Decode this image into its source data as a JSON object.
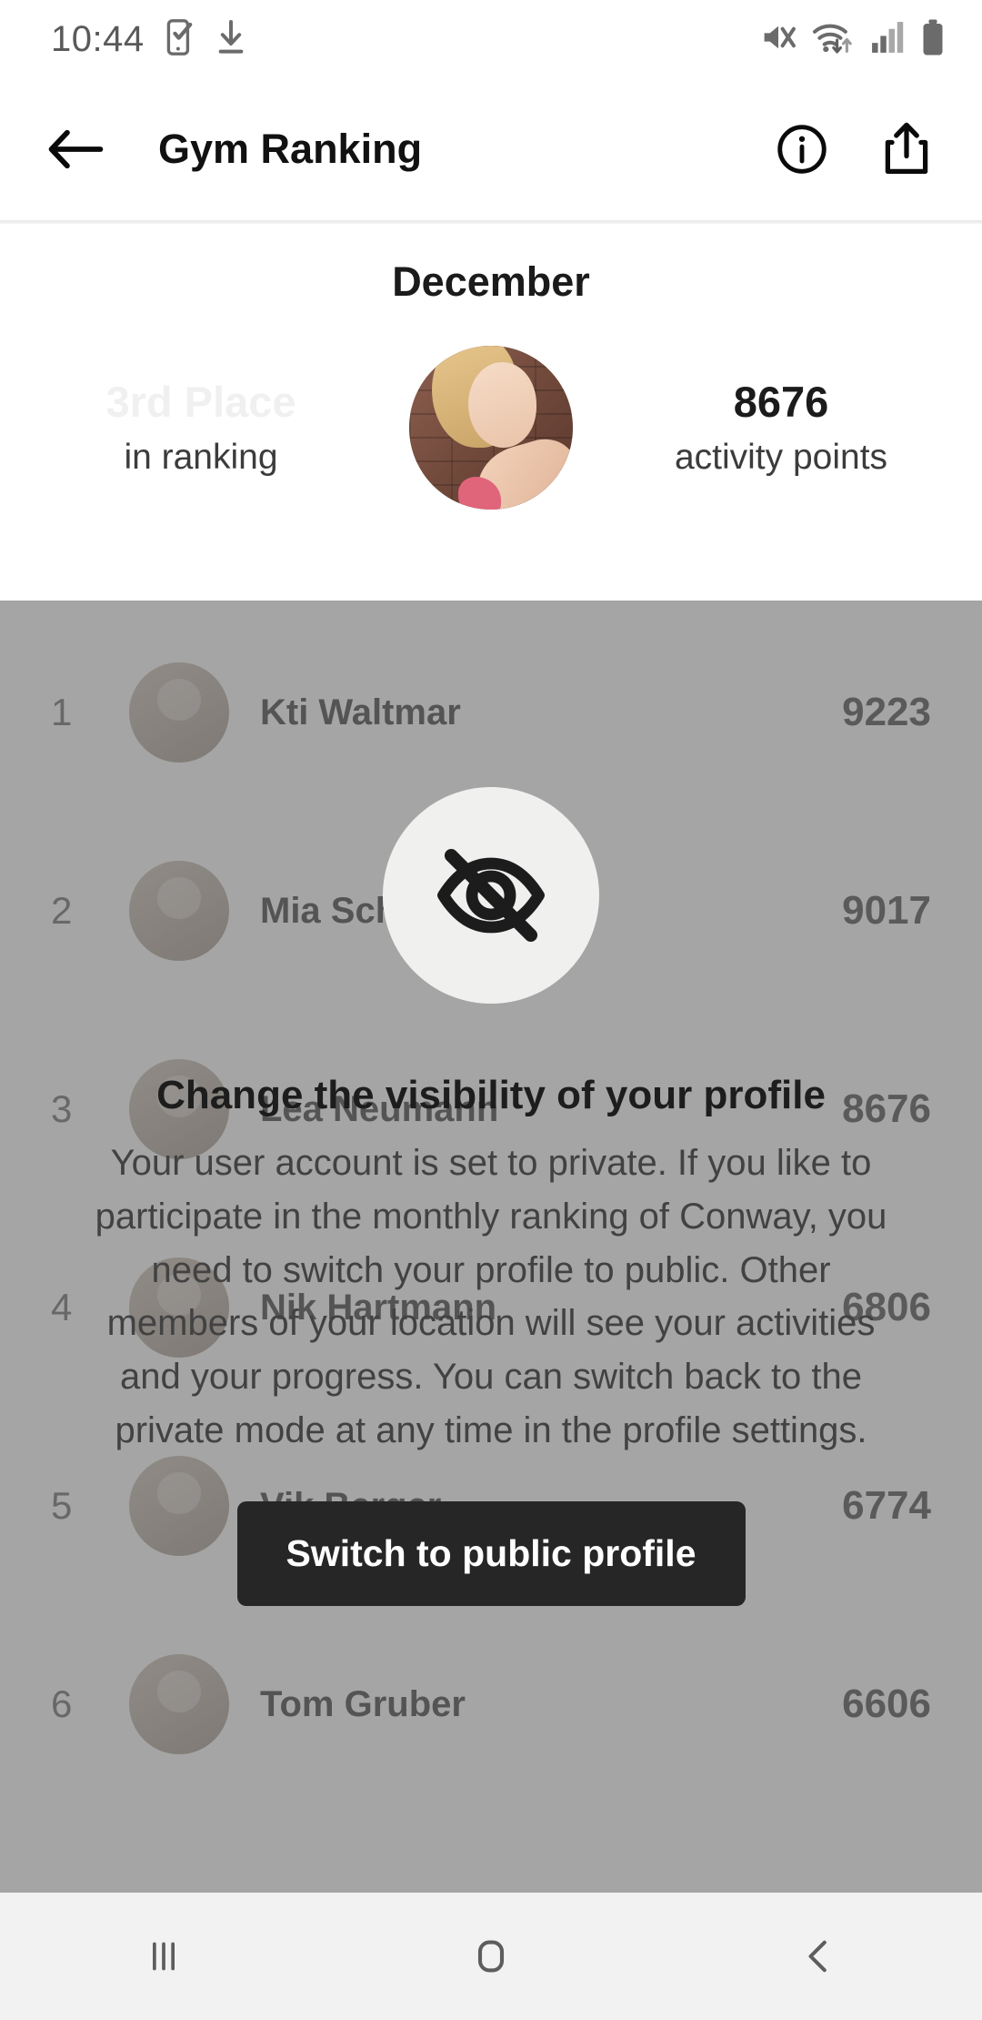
{
  "status_bar": {
    "time": "10:44",
    "left_icons": [
      "phone-check-icon",
      "download-icon"
    ],
    "right_icons": [
      "mute-icon",
      "wifi-icon",
      "cellular-signal-icon",
      "battery-icon"
    ]
  },
  "header": {
    "back_icon": "back-arrow-icon",
    "title": "Gym Ranking",
    "info_icon": "info-icon",
    "share_icon": "share-icon"
  },
  "summary": {
    "month": "December",
    "place_value": "3rd Place",
    "place_label": "in ranking",
    "points_value": "8676",
    "points_label": "activity points",
    "avatar": "user-avatar"
  },
  "ranking": {
    "rows": [
      {
        "position": "1",
        "name": "Kti Waltmar",
        "score": "9223"
      },
      {
        "position": "2",
        "name": "Mia Schreiber",
        "score": "9017"
      },
      {
        "position": "3",
        "name": "Lea Neumann",
        "score": "8676"
      },
      {
        "position": "4",
        "name": "Nik Hartmann",
        "score": "6806"
      },
      {
        "position": "5",
        "name": "Vik Berger",
        "score": "6774"
      },
      {
        "position": "6",
        "name": "Tom Gruber",
        "score": "6606"
      }
    ]
  },
  "modal": {
    "icon": "eye-off-icon",
    "title": "Change the visibility of your profile",
    "body": "Your user account is set to private. If you like to participate in the monthly ranking of Conway, you need to switch your profile to public. Other members of your location will see your activities and your progress. You can switch back to the private mode at any time in the profile settings.",
    "button_label": "Switch to public profile"
  },
  "nav_bar": {
    "recents_icon": "recents-icon",
    "home_icon": "home-icon",
    "back_icon": "nav-back-icon"
  },
  "colors": {
    "accent_dark": "#262626",
    "overlay": "#6e6e6e",
    "text_primary": "#1b1b1b",
    "text_secondary": "#424242",
    "faded": "#f0f0f0"
  }
}
